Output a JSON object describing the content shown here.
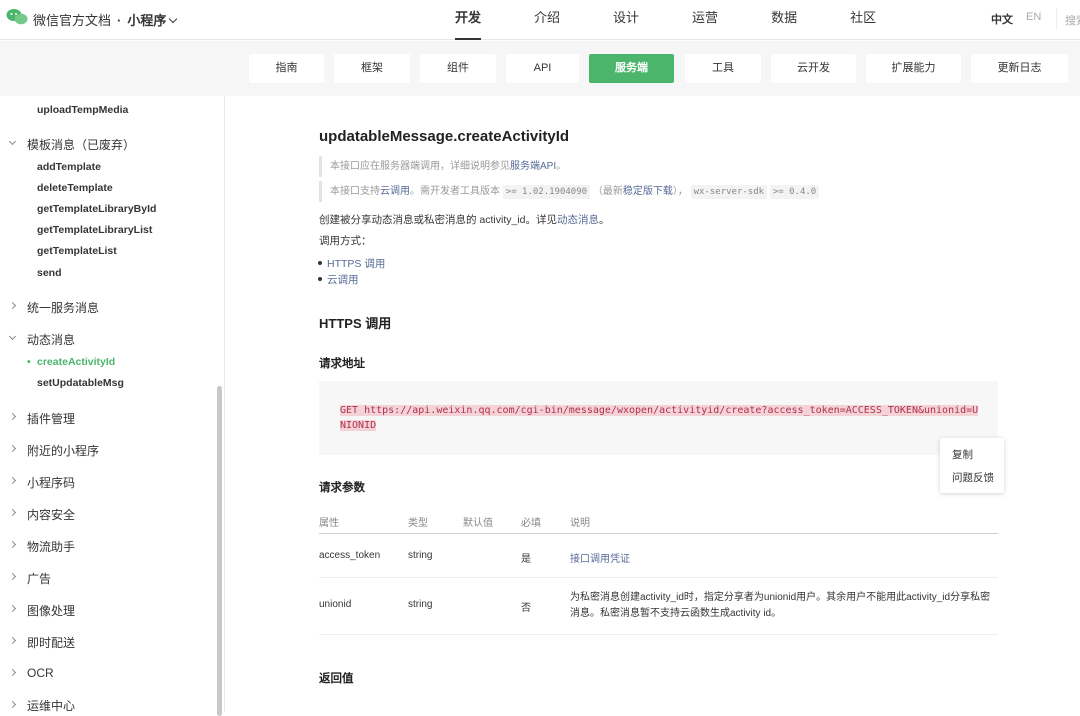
{
  "header": {
    "brand": "微信官方文档",
    "dot": "·",
    "product": "小程序",
    "nav": [
      "开发",
      "介绍",
      "设计",
      "运营",
      "数据",
      "社区"
    ],
    "lang_zh": "中文",
    "lang_en": "EN",
    "search_placeholder": "搜索"
  },
  "subnav": [
    "指南",
    "框架",
    "组件",
    "API",
    "服务端",
    "工具",
    "云开发",
    "扩展能力",
    "更新日志"
  ],
  "sidebar": {
    "top_item": "uploadTempMedia",
    "template_group": "模板消息（已废弃）",
    "template_items": [
      "addTemplate",
      "deleteTemplate",
      "getTemplateLibraryById",
      "getTemplateLibraryList",
      "getTemplateList",
      "send"
    ],
    "unified_group": "统一服务消息",
    "dynamic_group": "动态消息",
    "dynamic_items": [
      "createActivityId",
      "setUpdatableMsg"
    ],
    "other_groups": [
      "插件管理",
      "附近的小程序",
      "小程序码",
      "内容安全",
      "物流助手",
      "广告",
      "图像处理",
      "即时配送",
      "OCR",
      "运维中心"
    ]
  },
  "content": {
    "title": "updatableMessage.createActivityId",
    "note1_text": "本接口应在服务器端调用，详细说明参见",
    "note1_link": "服务端API",
    "note1_end": "。",
    "note2_a": "本接口支持",
    "note2_link1": "云调用",
    "note2_b": "。需开发者工具版本",
    "note2_code1": ">= 1.02.1904090",
    "note2_c": "（最新",
    "note2_link2": "稳定版下载",
    "note2_d": "），",
    "note2_code2": "wx-server-sdk",
    "note2_code3": ">= 0.4.0",
    "desc_text": "创建被分享动态消息或私密消息的 activity_id。详见",
    "desc_link": "动态消息",
    "desc_end": "。",
    "call_label": "调用方式：",
    "call_options": [
      "HTTPS 调用",
      "云调用"
    ],
    "https_heading": "HTTPS 调用",
    "url_heading": "请求地址",
    "request_url": "GET https://api.weixin.qq.com/cgi-bin/message/wxopen/activityid/create?access_token=ACCESS_TOKEN&unionid=UNIONID",
    "context_menu": [
      "复制",
      "问题反馈"
    ],
    "params_heading": "请求参数",
    "params_headers": [
      "属性",
      "类型",
      "默认值",
      "必填",
      "说明"
    ],
    "params_rows": [
      {
        "name": "access_token",
        "type": "string",
        "default": "",
        "required": "是",
        "desc": "接口调用凭证"
      },
      {
        "name": "unionid",
        "type": "string",
        "default": "",
        "required": "否",
        "desc": "为私密消息创建activity_id时，指定分享者为unionid用户。其余用户不能用此activity_id分享私密消息。私密消息暂不支持云函数生成activity id。"
      }
    ],
    "return_heading": "返回值"
  },
  "colors": {
    "accent": "#4ab56b",
    "link": "#576b95"
  }
}
